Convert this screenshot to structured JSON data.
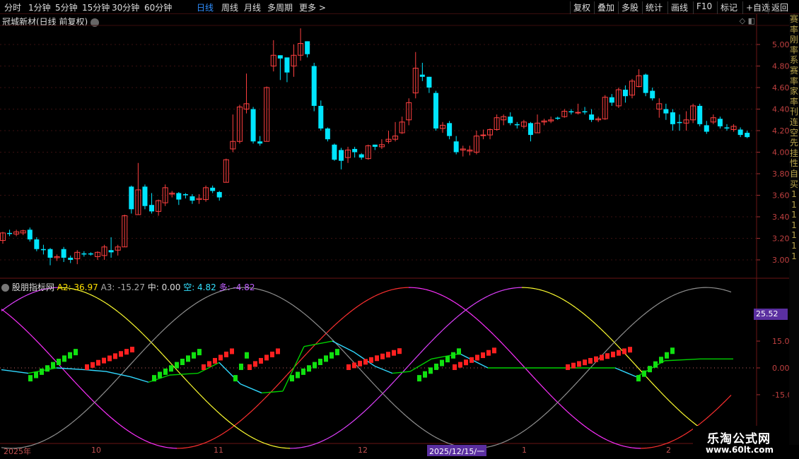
{
  "toolbar": {
    "periods": [
      "分时",
      "1分钟",
      "5分钟",
      "15分钟",
      "30分钟",
      "60分钟",
      "日线",
      "周线",
      "月线",
      "多周期",
      "更多 >"
    ],
    "active_period": "日线",
    "actions": [
      "复权",
      "叠加",
      "多股",
      "统计",
      "画线",
      "F10",
      "标记",
      "+自选",
      "返回"
    ]
  },
  "chart": {
    "title": "冠城新材(日线 前复权)",
    "price_axis": [
      "5.00",
      "4.80",
      "4.60",
      "4.40",
      "4.20",
      "4.00",
      "3.80",
      "3.60",
      "3.40",
      "3.20",
      "3.00"
    ],
    "up_color": "#ff4040",
    "down_color": "#00e5ff",
    "candles": [
      [
        3.18,
        3.25,
        3.26,
        3.15
      ],
      [
        3.25,
        3.24,
        3.28,
        3.22
      ],
      [
        3.24,
        3.26,
        3.28,
        3.22
      ],
      [
        3.25,
        3.27,
        3.28,
        3.23
      ],
      [
        3.28,
        3.19,
        3.3,
        3.17
      ],
      [
        3.19,
        3.1,
        3.21,
        3.08
      ],
      [
        3.1,
        3.09,
        3.14,
        3.05
      ],
      [
        3.1,
        3.02,
        3.11,
        2.95
      ],
      [
        3.02,
        3.03,
        3.05,
        2.99
      ],
      [
        3.1,
        3.02,
        3.12,
        2.98
      ],
      [
        3.02,
        3.0,
        3.04,
        2.97
      ],
      [
        3.01,
        3.07,
        3.09,
        2.96
      ],
      [
        3.06,
        3.05,
        3.08,
        3.03
      ],
      [
        3.06,
        3.05,
        3.07,
        3.04
      ],
      [
        3.03,
        3.07,
        3.08,
        3.0
      ],
      [
        3.04,
        3.12,
        3.14,
        3.0
      ],
      [
        3.09,
        3.07,
        3.21,
        3.02
      ],
      [
        3.09,
        3.12,
        3.14,
        3.04
      ],
      [
        3.12,
        3.41,
        3.42,
        3.12
      ],
      [
        3.68,
        3.47,
        3.69,
        3.43
      ],
      [
        3.42,
        3.65,
        3.9,
        3.42
      ],
      [
        3.68,
        3.5,
        3.7,
        3.47
      ],
      [
        3.51,
        3.45,
        3.62,
        3.43
      ],
      [
        3.45,
        3.55,
        3.56,
        3.41
      ],
      [
        3.53,
        3.67,
        3.7,
        3.5
      ],
      [
        3.61,
        3.62,
        3.64,
        3.58
      ],
      [
        3.62,
        3.56,
        3.63,
        3.51
      ],
      [
        3.61,
        3.6,
        3.62,
        3.57
      ],
      [
        3.59,
        3.55,
        3.61,
        3.52
      ],
      [
        3.56,
        3.57,
        3.61,
        3.52
      ],
      [
        3.56,
        3.67,
        3.69,
        3.54
      ],
      [
        3.67,
        3.64,
        3.69,
        3.62
      ],
      [
        3.63,
        3.58,
        3.64,
        3.55
      ],
      [
        3.72,
        3.93,
        3.94,
        3.72
      ],
      [
        4.03,
        4.1,
        4.35,
        4.0
      ],
      [
        4.1,
        4.42,
        4.44,
        4.08
      ],
      [
        4.4,
        4.45,
        4.73,
        4.36
      ],
      [
        4.4,
        4.1,
        4.42,
        4.08
      ],
      [
        4.1,
        4.08,
        4.15,
        4.06
      ],
      [
        4.1,
        4.6,
        4.61,
        4.1
      ],
      [
        4.8,
        4.9,
        5.04,
        4.75
      ],
      [
        4.9,
        4.87,
        4.9,
        4.67
      ],
      [
        4.88,
        4.74,
        4.83,
        4.65
      ],
      [
        4.8,
        4.9,
        5.0,
        4.7
      ],
      [
        4.9,
        5.01,
        5.15,
        4.85
      ],
      [
        5.03,
        4.91,
        5.03,
        4.88
      ],
      [
        4.8,
        4.43,
        4.83,
        4.38
      ],
      [
        4.43,
        4.22,
        4.48,
        4.2
      ],
      [
        4.22,
        4.12,
        4.23,
        4.1
      ],
      [
        4.07,
        3.93,
        4.08,
        3.92
      ],
      [
        4.02,
        3.92,
        4.04,
        3.84
      ],
      [
        3.95,
        4.02,
        4.05,
        3.9
      ],
      [
        4.03,
        4.0,
        4.05,
        3.95
      ],
      [
        3.98,
        3.95,
        3.99,
        3.93
      ],
      [
        3.94,
        4.06,
        4.07,
        3.93
      ],
      [
        4.07,
        4.05,
        4.07,
        4.02
      ],
      [
        4.05,
        4.07,
        4.12,
        4.03
      ],
      [
        4.1,
        4.12,
        4.2,
        4.08
      ],
      [
        4.12,
        4.15,
        4.28,
        4.1
      ],
      [
        4.18,
        4.28,
        4.33,
        4.17
      ],
      [
        4.3,
        4.46,
        4.5,
        4.25
      ],
      [
        4.55,
        4.78,
        4.93,
        4.5
      ],
      [
        4.72,
        4.7,
        4.83,
        4.66
      ],
      [
        4.7,
        4.6,
        4.7,
        4.55
      ],
      [
        4.55,
        4.22,
        4.57,
        4.2
      ],
      [
        4.22,
        4.25,
        4.28,
        4.18
      ],
      [
        4.27,
        4.15,
        4.29,
        4.12
      ],
      [
        4.1,
        4.0,
        4.15,
        3.98
      ],
      [
        4.02,
        4.03,
        4.06,
        3.96
      ],
      [
        4.01,
        4.02,
        4.06,
        3.97
      ],
      [
        4.0,
        4.15,
        4.2,
        3.98
      ],
      [
        4.16,
        4.16,
        4.21,
        4.12
      ],
      [
        4.16,
        4.21,
        4.22,
        4.12
      ],
      [
        4.21,
        4.32,
        4.35,
        4.2
      ],
      [
        4.3,
        4.33,
        4.35,
        4.25
      ],
      [
        4.33,
        4.27,
        4.37,
        4.25
      ],
      [
        4.26,
        4.25,
        4.28,
        4.22
      ],
      [
        4.24,
        4.28,
        4.3,
        4.22
      ],
      [
        4.27,
        4.16,
        4.28,
        4.1
      ],
      [
        4.18,
        4.27,
        4.35,
        4.18
      ],
      [
        4.28,
        4.29,
        4.31,
        4.25
      ],
      [
        4.29,
        4.3,
        4.33,
        4.27
      ],
      [
        4.32,
        4.31,
        4.33,
        4.3
      ],
      [
        4.33,
        4.38,
        4.4,
        4.32
      ],
      [
        4.38,
        4.37,
        4.4,
        4.35
      ],
      [
        4.37,
        4.37,
        4.45,
        4.35
      ],
      [
        4.38,
        4.37,
        4.42,
        4.35
      ],
      [
        4.35,
        4.3,
        4.4,
        4.28
      ],
      [
        4.3,
        4.31,
        4.33,
        4.28
      ],
      [
        4.31,
        4.51,
        4.53,
        4.3
      ],
      [
        4.51,
        4.46,
        4.54,
        4.43
      ],
      [
        4.43,
        4.58,
        4.6,
        4.41
      ],
      [
        4.58,
        4.52,
        4.62,
        4.46
      ],
      [
        4.53,
        4.66,
        4.68,
        4.5
      ],
      [
        4.61,
        4.71,
        4.77,
        4.6
      ],
      [
        4.72,
        4.55,
        4.73,
        4.52
      ],
      [
        4.57,
        4.5,
        4.6,
        4.48
      ],
      [
        4.4,
        4.45,
        4.5,
        4.32
      ],
      [
        4.4,
        4.36,
        4.45,
        4.3
      ],
      [
        4.37,
        4.26,
        4.4,
        4.2
      ],
      [
        4.28,
        4.27,
        4.35,
        4.2
      ],
      [
        4.27,
        4.3,
        4.38,
        4.2
      ],
      [
        4.3,
        4.43,
        4.45,
        4.27
      ],
      [
        4.43,
        4.26,
        4.45,
        4.24
      ],
      [
        4.25,
        4.19,
        4.29,
        4.17
      ],
      [
        4.28,
        4.32,
        4.35,
        4.26
      ],
      [
        4.31,
        4.24,
        4.33,
        4.22
      ],
      [
        4.23,
        4.22,
        4.26,
        4.2
      ],
      [
        4.21,
        4.24,
        4.26,
        4.19
      ],
      [
        4.21,
        4.16,
        4.23,
        4.14
      ],
      [
        4.18,
        4.14,
        4.2,
        4.13
      ]
    ]
  },
  "indicator": {
    "name": "股朋指标网",
    "a2_label": "A2: 36.97",
    "a3_label": "A3: -15.27",
    "zhong_label": "中: 0.00",
    "kong_label": "空: 4.82",
    "duo_label": "多: -4.82",
    "axis": [
      "15.00",
      "0.00",
      "-15.00"
    ],
    "a2_value": "25.52"
  },
  "date_axis": {
    "labels": [
      "2025年",
      "10",
      "11",
      "12",
      "1",
      "2"
    ],
    "cursor": "2025/12/15/一"
  },
  "right_strip": [
    "赛",
    "率",
    "刚",
    "率",
    "系",
    "赛",
    "率",
    "家",
    "率",
    "刊",
    "连",
    "空",
    "先",
    "挂",
    "性",
    "自",
    "买",
    "1",
    "1",
    "1",
    "1",
    "1",
    "1",
    "1"
  ],
  "watermark": {
    "line1": "乐淘公式网",
    "line2": "www.60lt.com"
  }
}
